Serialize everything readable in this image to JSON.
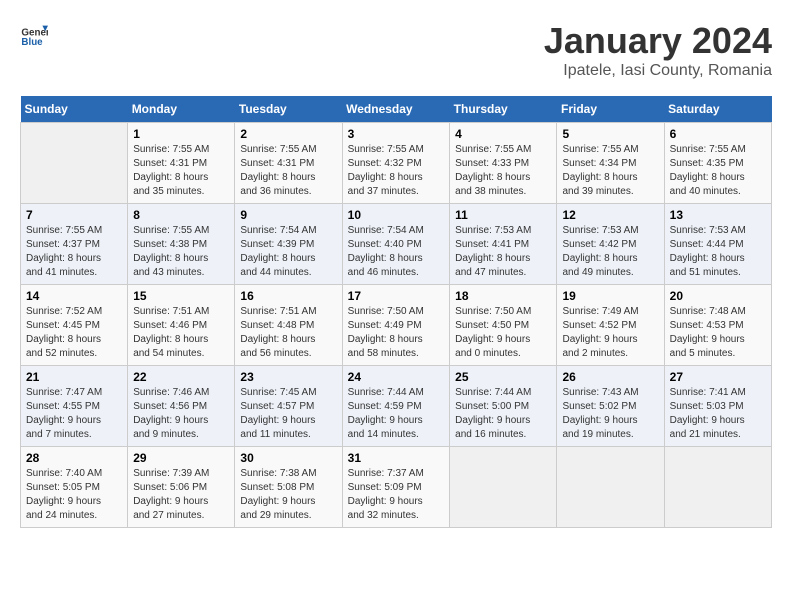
{
  "logo": {
    "general": "General",
    "blue": "Blue"
  },
  "title": "January 2024",
  "subtitle": "Ipatele, Iasi County, Romania",
  "days_header": [
    "Sunday",
    "Monday",
    "Tuesday",
    "Wednesday",
    "Thursday",
    "Friday",
    "Saturday"
  ],
  "weeks": [
    [
      {
        "day": "",
        "info": ""
      },
      {
        "day": "1",
        "info": "Sunrise: 7:55 AM\nSunset: 4:31 PM\nDaylight: 8 hours\nand 35 minutes."
      },
      {
        "day": "2",
        "info": "Sunrise: 7:55 AM\nSunset: 4:31 PM\nDaylight: 8 hours\nand 36 minutes."
      },
      {
        "day": "3",
        "info": "Sunrise: 7:55 AM\nSunset: 4:32 PM\nDaylight: 8 hours\nand 37 minutes."
      },
      {
        "day": "4",
        "info": "Sunrise: 7:55 AM\nSunset: 4:33 PM\nDaylight: 8 hours\nand 38 minutes."
      },
      {
        "day": "5",
        "info": "Sunrise: 7:55 AM\nSunset: 4:34 PM\nDaylight: 8 hours\nand 39 minutes."
      },
      {
        "day": "6",
        "info": "Sunrise: 7:55 AM\nSunset: 4:35 PM\nDaylight: 8 hours\nand 40 minutes."
      }
    ],
    [
      {
        "day": "7",
        "info": "Sunrise: 7:55 AM\nSunset: 4:37 PM\nDaylight: 8 hours\nand 41 minutes."
      },
      {
        "day": "8",
        "info": "Sunrise: 7:55 AM\nSunset: 4:38 PM\nDaylight: 8 hours\nand 43 minutes."
      },
      {
        "day": "9",
        "info": "Sunrise: 7:54 AM\nSunset: 4:39 PM\nDaylight: 8 hours\nand 44 minutes."
      },
      {
        "day": "10",
        "info": "Sunrise: 7:54 AM\nSunset: 4:40 PM\nDaylight: 8 hours\nand 46 minutes."
      },
      {
        "day": "11",
        "info": "Sunrise: 7:53 AM\nSunset: 4:41 PM\nDaylight: 8 hours\nand 47 minutes."
      },
      {
        "day": "12",
        "info": "Sunrise: 7:53 AM\nSunset: 4:42 PM\nDaylight: 8 hours\nand 49 minutes."
      },
      {
        "day": "13",
        "info": "Sunrise: 7:53 AM\nSunset: 4:44 PM\nDaylight: 8 hours\nand 51 minutes."
      }
    ],
    [
      {
        "day": "14",
        "info": "Sunrise: 7:52 AM\nSunset: 4:45 PM\nDaylight: 8 hours\nand 52 minutes."
      },
      {
        "day": "15",
        "info": "Sunrise: 7:51 AM\nSunset: 4:46 PM\nDaylight: 8 hours\nand 54 minutes."
      },
      {
        "day": "16",
        "info": "Sunrise: 7:51 AM\nSunset: 4:48 PM\nDaylight: 8 hours\nand 56 minutes."
      },
      {
        "day": "17",
        "info": "Sunrise: 7:50 AM\nSunset: 4:49 PM\nDaylight: 8 hours\nand 58 minutes."
      },
      {
        "day": "18",
        "info": "Sunrise: 7:50 AM\nSunset: 4:50 PM\nDaylight: 9 hours\nand 0 minutes."
      },
      {
        "day": "19",
        "info": "Sunrise: 7:49 AM\nSunset: 4:52 PM\nDaylight: 9 hours\nand 2 minutes."
      },
      {
        "day": "20",
        "info": "Sunrise: 7:48 AM\nSunset: 4:53 PM\nDaylight: 9 hours\nand 5 minutes."
      }
    ],
    [
      {
        "day": "21",
        "info": "Sunrise: 7:47 AM\nSunset: 4:55 PM\nDaylight: 9 hours\nand 7 minutes."
      },
      {
        "day": "22",
        "info": "Sunrise: 7:46 AM\nSunset: 4:56 PM\nDaylight: 9 hours\nand 9 minutes."
      },
      {
        "day": "23",
        "info": "Sunrise: 7:45 AM\nSunset: 4:57 PM\nDaylight: 9 hours\nand 11 minutes."
      },
      {
        "day": "24",
        "info": "Sunrise: 7:44 AM\nSunset: 4:59 PM\nDaylight: 9 hours\nand 14 minutes."
      },
      {
        "day": "25",
        "info": "Sunrise: 7:44 AM\nSunset: 5:00 PM\nDaylight: 9 hours\nand 16 minutes."
      },
      {
        "day": "26",
        "info": "Sunrise: 7:43 AM\nSunset: 5:02 PM\nDaylight: 9 hours\nand 19 minutes."
      },
      {
        "day": "27",
        "info": "Sunrise: 7:41 AM\nSunset: 5:03 PM\nDaylight: 9 hours\nand 21 minutes."
      }
    ],
    [
      {
        "day": "28",
        "info": "Sunrise: 7:40 AM\nSunset: 5:05 PM\nDaylight: 9 hours\nand 24 minutes."
      },
      {
        "day": "29",
        "info": "Sunrise: 7:39 AM\nSunset: 5:06 PM\nDaylight: 9 hours\nand 27 minutes."
      },
      {
        "day": "30",
        "info": "Sunrise: 7:38 AM\nSunset: 5:08 PM\nDaylight: 9 hours\nand 29 minutes."
      },
      {
        "day": "31",
        "info": "Sunrise: 7:37 AM\nSunset: 5:09 PM\nDaylight: 9 hours\nand 32 minutes."
      },
      {
        "day": "",
        "info": ""
      },
      {
        "day": "",
        "info": ""
      },
      {
        "day": "",
        "info": ""
      }
    ]
  ]
}
